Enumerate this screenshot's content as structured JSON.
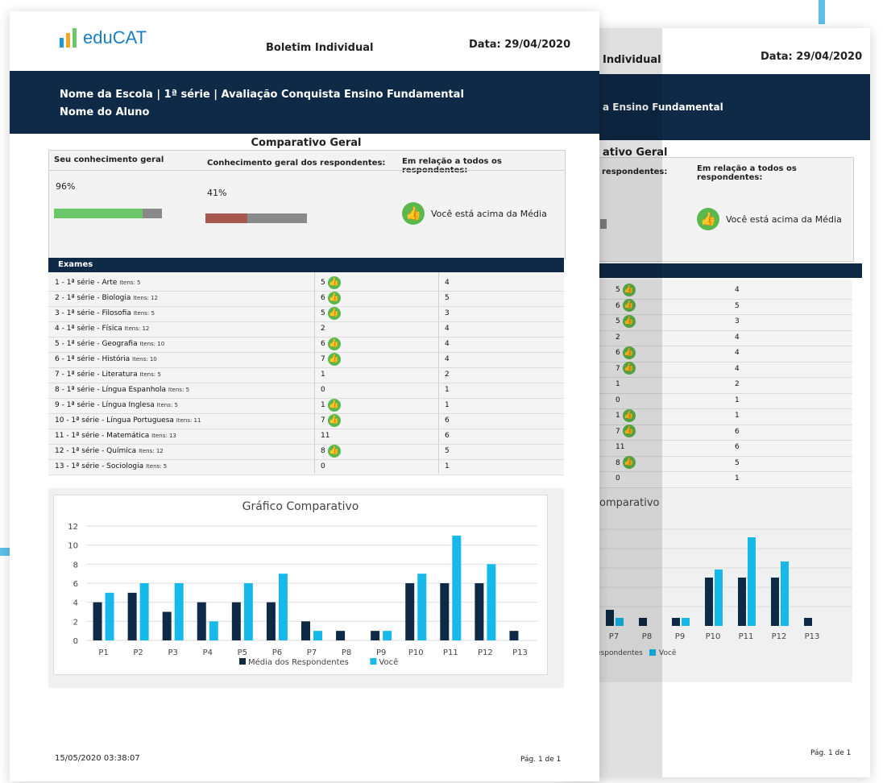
{
  "doc": {
    "title": "Boletim Individual",
    "date": "Data: 29/04/2020",
    "brand": "eduCAT",
    "header_line1": "Nome da Escola | 1ª série | Avaliação Conquista Ensino Fundamental",
    "header_line2": "Nome do Aluno",
    "footer_timestamp": "15/05/2020 03:38:07",
    "footer_page": "Pág. 1 de 1"
  },
  "back_page": {
    "title": "Individual",
    "date": "Data: 29/04/2020",
    "header_line1": "a Ensino Fundamental",
    "summary_title": "ativo Geral",
    "col2": "respondentes:",
    "col3": "Em relação a todos os respondentes:",
    "verdict": "Você está acima da Média",
    "chart_title": "omparativo",
    "legend": "espondentes",
    "legend_you": "Você",
    "footer_page": "Pág. 1 de 1"
  },
  "summary": {
    "title": "Comparativo Geral",
    "col1": "Seu conhecimento geral",
    "col2": "Conhecimento geral dos respondentes:",
    "col3": "Em relação a todos os respondentes:",
    "student_pct": "96%",
    "student_fill": 0.82,
    "group_pct": "41%",
    "group_fill": 0.41,
    "verdict": "Você está acima da Média",
    "colors": {
      "student": "#6cc66a",
      "group": "#a8574f",
      "track": "#8a8a8a"
    }
  },
  "exams": {
    "header": "Exames",
    "items_label": "Itens:",
    "rows": [
      {
        "name": "1 - 1ª série - Arte",
        "items": "5",
        "you": "5",
        "thumb": true,
        "avg": "4"
      },
      {
        "name": "2 - 1ª série - Biologia",
        "items": "12",
        "you": "6",
        "thumb": true,
        "avg": "5"
      },
      {
        "name": "3 - 1ª série - Filosofia",
        "items": "5",
        "you": "5",
        "thumb": true,
        "avg": "3"
      },
      {
        "name": "4 - 1ª série - Física",
        "items": "12",
        "you": "2",
        "thumb": false,
        "avg": "4"
      },
      {
        "name": "5 - 1ª série - Geografia",
        "items": "10",
        "you": "6",
        "thumb": true,
        "avg": "4"
      },
      {
        "name": "6 - 1ª série - História",
        "items": "10",
        "you": "7",
        "thumb": true,
        "avg": "4"
      },
      {
        "name": "7 - 1ª série - Literatura",
        "items": "5",
        "you": "1",
        "thumb": false,
        "avg": "2"
      },
      {
        "name": "8 - 1ª série - Língua Espanhola",
        "items": "5",
        "you": "0",
        "thumb": false,
        "avg": "1"
      },
      {
        "name": "9 - 1ª série - Língua Inglesa",
        "items": "5",
        "you": "1",
        "thumb": true,
        "avg": "1"
      },
      {
        "name": "10 - 1ª série - Língua Portuguesa",
        "items": "11",
        "you": "7",
        "thumb": true,
        "avg": "6"
      },
      {
        "name": "11 - 1ª série - Matemática",
        "items": "13",
        "you": "11",
        "thumb": false,
        "avg": "6"
      },
      {
        "name": "12 - 1ª série - Química",
        "items": "12",
        "you": "8",
        "thumb": true,
        "avg": "5"
      },
      {
        "name": "13 - 1ª série - Sociologia",
        "items": "5",
        "you": "0",
        "thumb": false,
        "avg": "1"
      }
    ]
  },
  "chart_data": {
    "type": "bar",
    "title": "Gráfico Comparativo",
    "categories": [
      "P1",
      "P2",
      "P3",
      "P4",
      "P5",
      "P6",
      "P7",
      "P8",
      "P9",
      "P10",
      "P11",
      "P12",
      "P13"
    ],
    "series": [
      {
        "name": "Média dos Respondentes",
        "color": "#0f2a47",
        "values": [
          4,
          5,
          3,
          4,
          4,
          4,
          2,
          1,
          1,
          6,
          6,
          6,
          1
        ]
      },
      {
        "name": "Você",
        "color": "#16b9ea",
        "values": [
          5,
          6,
          6,
          2,
          6,
          7,
          1,
          0,
          1,
          7,
          11,
          8,
          0
        ]
      }
    ],
    "ylim": [
      0,
      12
    ],
    "yticks": [
      "0",
      "2",
      "4",
      "6",
      "8",
      "10",
      "12"
    ],
    "grid": true,
    "legend": "bottom"
  }
}
